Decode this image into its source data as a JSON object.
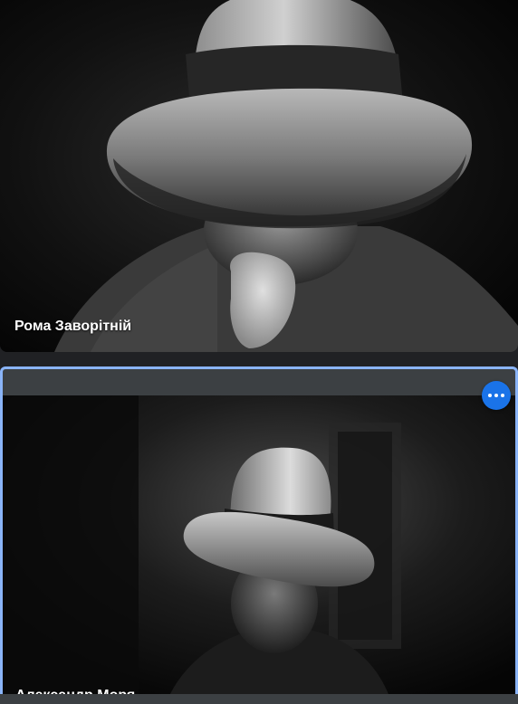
{
  "participants": [
    {
      "name": "Рома Заворітній"
    },
    {
      "name": "Александр Моря"
    }
  ],
  "colors": {
    "background": "#202124",
    "active_speaker_border": "#8ab4f8",
    "more_button": "#1a73e8",
    "tile_header": "#3c4043"
  },
  "icons": {
    "more_options": "more-horizontal-icon"
  }
}
